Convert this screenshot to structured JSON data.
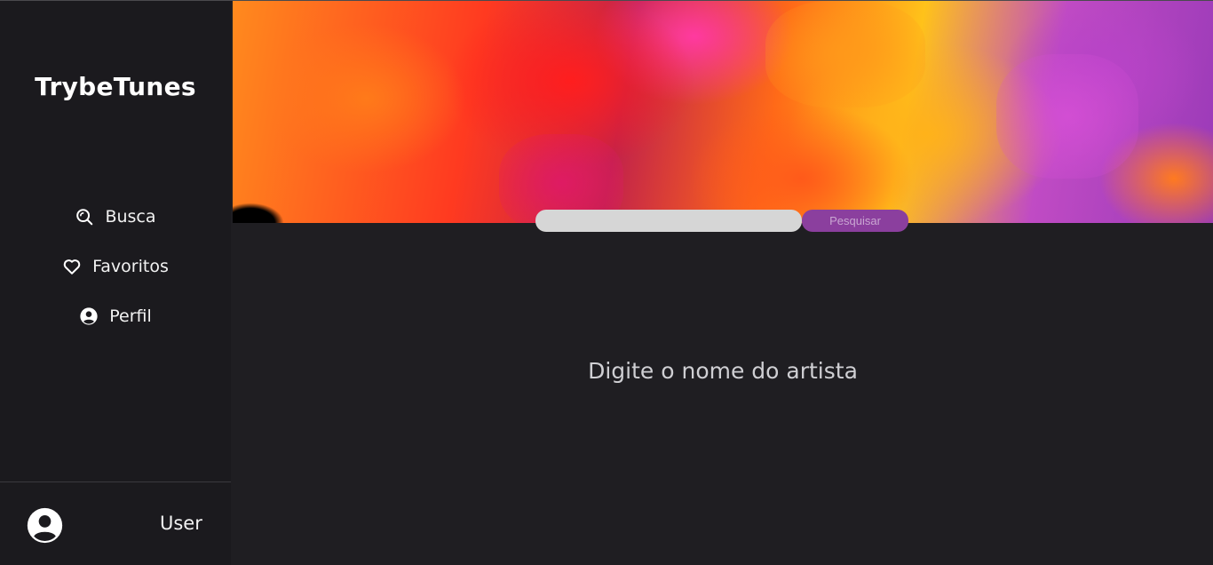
{
  "sidebar": {
    "logo": "TrybeTunes",
    "nav": [
      {
        "label": "Busca",
        "icon": "search-icon"
      },
      {
        "label": "Favoritos",
        "icon": "heart-icon"
      },
      {
        "label": "Perfil",
        "icon": "user-circle-icon"
      }
    ],
    "user": {
      "name": "User",
      "icon": "user-avatar-icon"
    }
  },
  "search": {
    "value": "",
    "placeholder": "",
    "button_label": "Pesquisar"
  },
  "main": {
    "hint": "Digite o nome do artista"
  },
  "colors": {
    "background": "#1f1e22",
    "sidebar": "#1b1a1e",
    "accent": "#8b3f9e"
  }
}
